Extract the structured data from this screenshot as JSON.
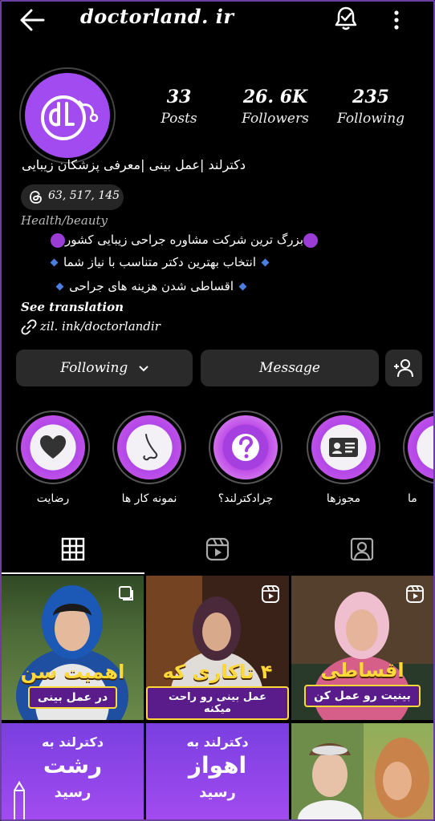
{
  "header": {
    "username": "doctorland. ir"
  },
  "profile": {
    "avatar_color": "#a24bf0",
    "stats": [
      {
        "value": "33",
        "label": "Posts"
      },
      {
        "value": "26. 6K",
        "label": "Followers"
      },
      {
        "value": "235",
        "label": "Following"
      }
    ],
    "name": "دکترلند |عمل بینی |معرفی پزشکان زیبایی",
    "threads_count": "63, 517, 145",
    "category": "Health/beauty",
    "bio_lines": [
      "بزرگ ترین شرکت مشاوره جراحی زیبایی کشور",
      "انتخاب بهترین دکتر متناسب با نیاز شما",
      "اقساطی شدن هزینه های جراحی"
    ],
    "see_translation": "See translation",
    "link": "zil. ink/doctorlandir"
  },
  "actions": {
    "following_label": "Following",
    "message_label": "Message"
  },
  "highlights": [
    {
      "label": "رضایت",
      "icon": "heart-icon"
    },
    {
      "label": "نمونه کار ها",
      "icon": "nose-icon"
    },
    {
      "label": "چرادکترلند؟",
      "icon": "question-icon"
    },
    {
      "label": "مجوزها",
      "icon": "id-card-icon"
    },
    {
      "label": "ما",
      "icon": "partial-icon"
    }
  ],
  "tabs": [
    {
      "name": "grid-icon"
    },
    {
      "name": "reels-icon"
    },
    {
      "name": "tagged-icon"
    }
  ],
  "posts": [
    {
      "line1": "اهمیت سن",
      "line2": "در عمل بینی"
    },
    {
      "line1": "۴ تاکاری که",
      "line2": "عمل بینی رو راحت میکنه"
    },
    {
      "line1": "اقساطی",
      "line2": "بینیت رو عمل کن"
    },
    {
      "line1": "دکترلند به",
      "line2": "رشت",
      "line3": "رسید"
    },
    {
      "line1": "دکترلند به",
      "line2": "اهواز",
      "line3": "رسید"
    },
    {
      "line1": ""
    }
  ],
  "colors": {
    "accent": "#9b3cd6",
    "button_bg": "#2a2a2a",
    "tag_yellow": "#ffd93a"
  }
}
